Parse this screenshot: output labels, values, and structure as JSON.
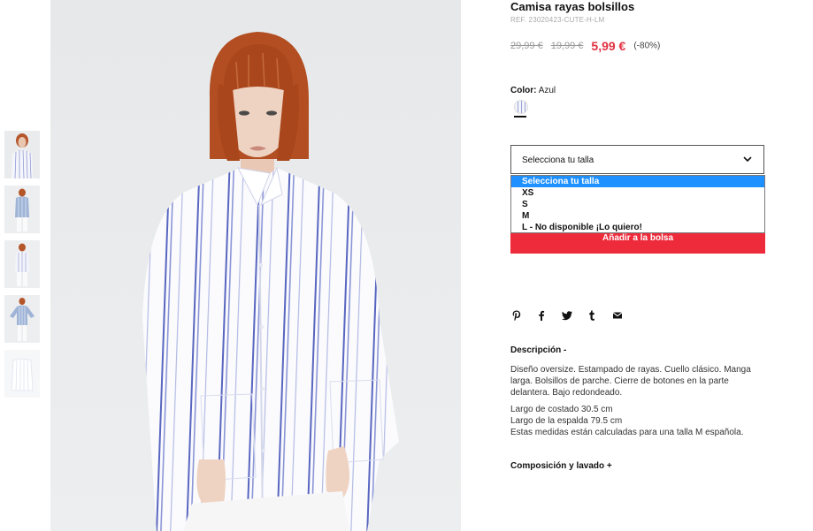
{
  "product": {
    "title": "Camisa rayas bolsillos",
    "ref": "REF. 23020423-CUTE-H-LM",
    "price_original_1": "29,99 €",
    "price_original_2": "19,99 €",
    "price_current": "5,99 €",
    "discount": "(-80%)"
  },
  "color": {
    "label": "Color:",
    "value": "Azul",
    "swatch_icon": "striped-swatch-icon"
  },
  "size": {
    "select_label": "Selecciona tu talla",
    "options": [
      "Selecciona tu talla",
      "XS",
      "S",
      "M",
      "L - No disponible ¡Lo quiero!"
    ],
    "selected_index": 0
  },
  "cart": {
    "add_label": "Añadir a la bolsa"
  },
  "share_icons": [
    "pinterest-icon",
    "facebook-icon",
    "twitter-icon",
    "tumblr-icon",
    "email-icon"
  ],
  "description": {
    "heading": "Descripción -",
    "body": "Diseño oversize. Estampado de rayas. Cuello clásico. Manga larga. Bolsillos de parche. Cierre de botones en la parte delantera. Bajo redondeado.",
    "measure_1": "Largo de costado 30.5 cm",
    "measure_2": "Largo de la espalda 79.5 cm",
    "measure_note": "Estas medidas están calculadas para una talla M española."
  },
  "composition": {
    "heading": "Composición y lavado +"
  },
  "colors": {
    "price_red": "#e03140",
    "button_red": "#ee2b3b",
    "option_highlight": "#1e90ff"
  }
}
